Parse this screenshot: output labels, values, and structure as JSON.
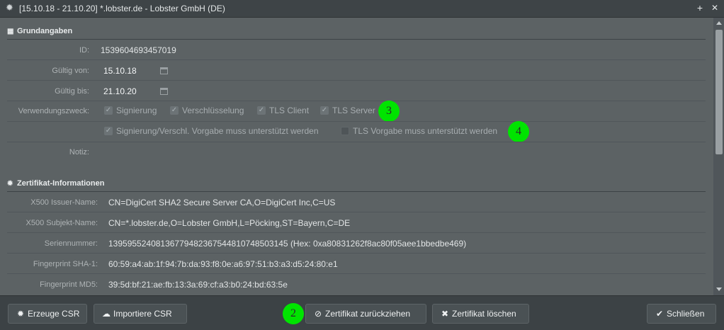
{
  "window": {
    "title": "[15.10.18 - 21.10.20] *.lobster.de - Lobster GmbH (DE)",
    "icon": "gear-icon"
  },
  "titlebar_buttons": {
    "add": "+",
    "close": "✕"
  },
  "grundangaben": {
    "heading": "Grundangaben",
    "id_label": "ID:",
    "id_value": "1539604693457019",
    "gueltig_von_label": "Gültig von:",
    "gueltig_von_value": "15.10.18",
    "gueltig_bis_label": "Gültig bis:",
    "gueltig_bis_value": "21.10.20",
    "verwendungszweck_label": "Verwendungszweck:",
    "checkboxes": [
      {
        "label": "Signierung",
        "checked": true
      },
      {
        "label": "Verschlüsselung",
        "checked": true
      },
      {
        "label": "TLS Client",
        "checked": true
      },
      {
        "label": "TLS Server",
        "checked": true
      },
      {
        "label": "Signierung/Verschl. Vorgabe muss unterstützt werden",
        "checked": true
      },
      {
        "label": "TLS Vorgabe muss unterstützt werden",
        "checked": false
      }
    ],
    "notiz_label": "Notiz:"
  },
  "zertifikat": {
    "heading": "Zertifikat-Informationen",
    "rows": [
      {
        "label": "X500 Issuer-Name:",
        "value": "CN=DigiCert SHA2 Secure Server CA,O=DigiCert Inc,C=US"
      },
      {
        "label": "X500 Subjekt-Name:",
        "value": "CN=*.lobster.de,O=Lobster GmbH,L=Pöcking,ST=Bayern,C=DE"
      },
      {
        "label": "Seriennummer:",
        "value": "13959552408136779482367544810748503145 (Hex: 0xa80831262f8ac80f05aee1bbedbe469)"
      },
      {
        "label": "Fingerprint SHA-1:",
        "value": "60:59:a4:ab:1f:94:7b:da:93:f8:0e:a6:97:51:b3:a3:d5:24:80:e1"
      },
      {
        "label": "Fingerprint MD5:",
        "value": "39:5d:bf:21:ae:fb:13:3a:69:cf:a3:b0:24:bd:63:5e"
      }
    ]
  },
  "markers": [
    "3",
    "4",
    "2"
  ],
  "footer": {
    "erzeuge_csr": "Erzeuge CSR",
    "importiere_csr": "Importiere CSR",
    "zurueckziehen": "Zertifikat zurückziehen",
    "loeschen": "Zertifikat löschen",
    "schliessen": "Schließen"
  }
}
